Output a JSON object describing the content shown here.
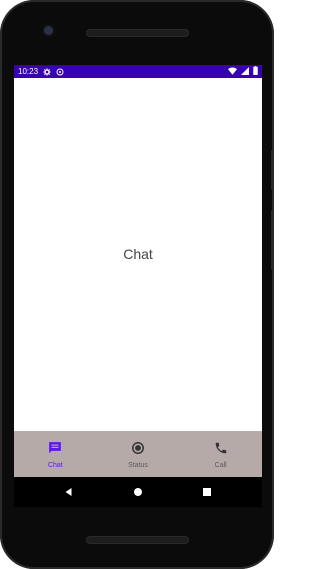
{
  "status_bar": {
    "time": "10:23",
    "left_icons": [
      "settings-icon",
      "sync-icon"
    ],
    "right_icons": [
      "wifi-icon",
      "signal-icon",
      "battery-icon"
    ],
    "bg_color": "#3700b3"
  },
  "main": {
    "title": "Chat"
  },
  "bottom_nav": {
    "items": [
      {
        "label": "Chat",
        "icon": "chat-icon",
        "active": true
      },
      {
        "label": "Status",
        "icon": "status-icon",
        "active": false
      },
      {
        "label": "Call",
        "icon": "phone-icon",
        "active": false
      }
    ],
    "bg_color": "#b5aaa8",
    "active_color": "#5e17eb"
  },
  "system_nav": {
    "buttons": [
      "back-icon",
      "home-icon",
      "recents-icon"
    ]
  }
}
